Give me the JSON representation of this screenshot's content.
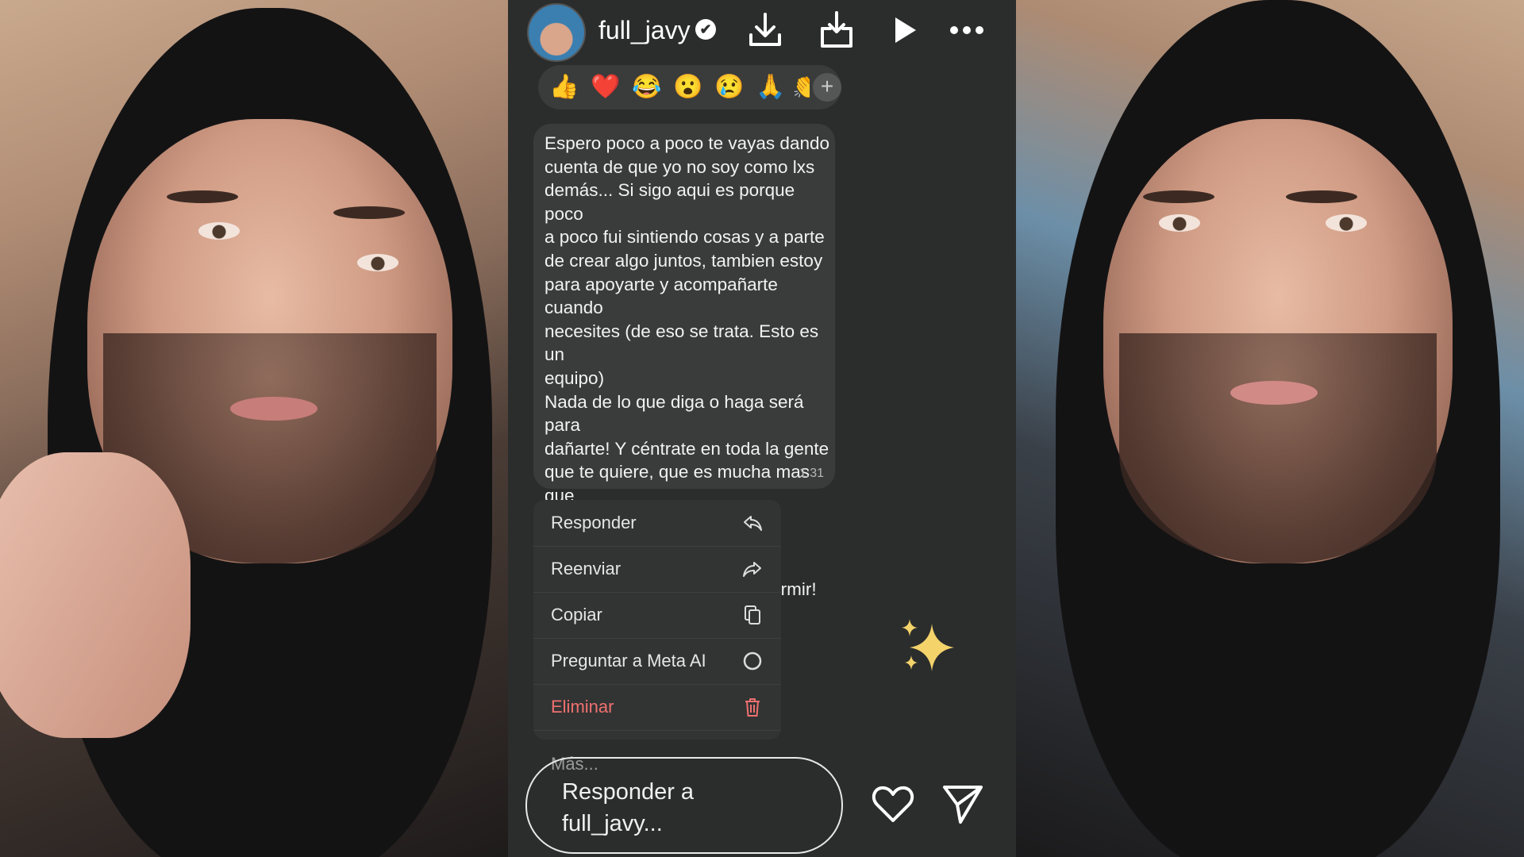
{
  "story": {
    "username": "full_javy",
    "verified_mark": "✔"
  },
  "top_actions": [
    {
      "name": "download-icon"
    },
    {
      "name": "save-to-folder-icon"
    },
    {
      "name": "play-icon"
    },
    {
      "name": "more-options-icon"
    }
  ],
  "reactions": [
    {
      "emoji": "👍",
      "name": "thumbs-up-reaction"
    },
    {
      "emoji": "❤️",
      "name": "heart-reaction",
      "selected": true
    },
    {
      "emoji": "😂",
      "name": "laughing-reaction"
    },
    {
      "emoji": "😮",
      "name": "surprised-reaction"
    },
    {
      "emoji": "😢",
      "name": "crying-reaction"
    },
    {
      "emoji": "🙏",
      "name": "praying-hands-reaction"
    },
    {
      "emoji": "👏",
      "name": "clapping-reaction"
    }
  ],
  "reaction_more": "+",
  "message": {
    "text": "Espero poco a poco te vayas dando\ncuenta de que yo no soy como lxs\ndemás... Si sigo aqui es porque poco\na poco fui sintiendo cosas y a parte\nde crear algo juntos, tambien estoy\npara apoyarte y acompañarte cuando\nnecesites (de eso se trata. Esto es un\nequipo)\nNada de lo que diga o haga será para\ndañarte! Y céntrate en toda la gente\nque te quiere, que es mucha mas que\nla que no (aunque las que no puedan\nhacer “mas” ruido)\nDespués de esto me voy a dormir!\nDescansa ❤️",
    "time": "1:31"
  },
  "context_menu": {
    "items": [
      {
        "label": "Responder",
        "icon": "reply-icon"
      },
      {
        "label": "Reenviar",
        "icon": "forward-icon"
      },
      {
        "label": "Copiar",
        "icon": "copy-icon"
      },
      {
        "label": "Preguntar a Meta AI",
        "icon": "meta-ai-icon"
      },
      {
        "label": "Eliminar",
        "icon": "trash-icon",
        "danger": true
      }
    ],
    "more_label": "Más..."
  },
  "reply": {
    "placeholder": "Responder a full_javy..."
  },
  "colors": {
    "panel_bg": "#2b2d2c",
    "bubble_bg": "#3a3c3b",
    "danger": "#f07070",
    "sparkle": "#f5d36b"
  }
}
